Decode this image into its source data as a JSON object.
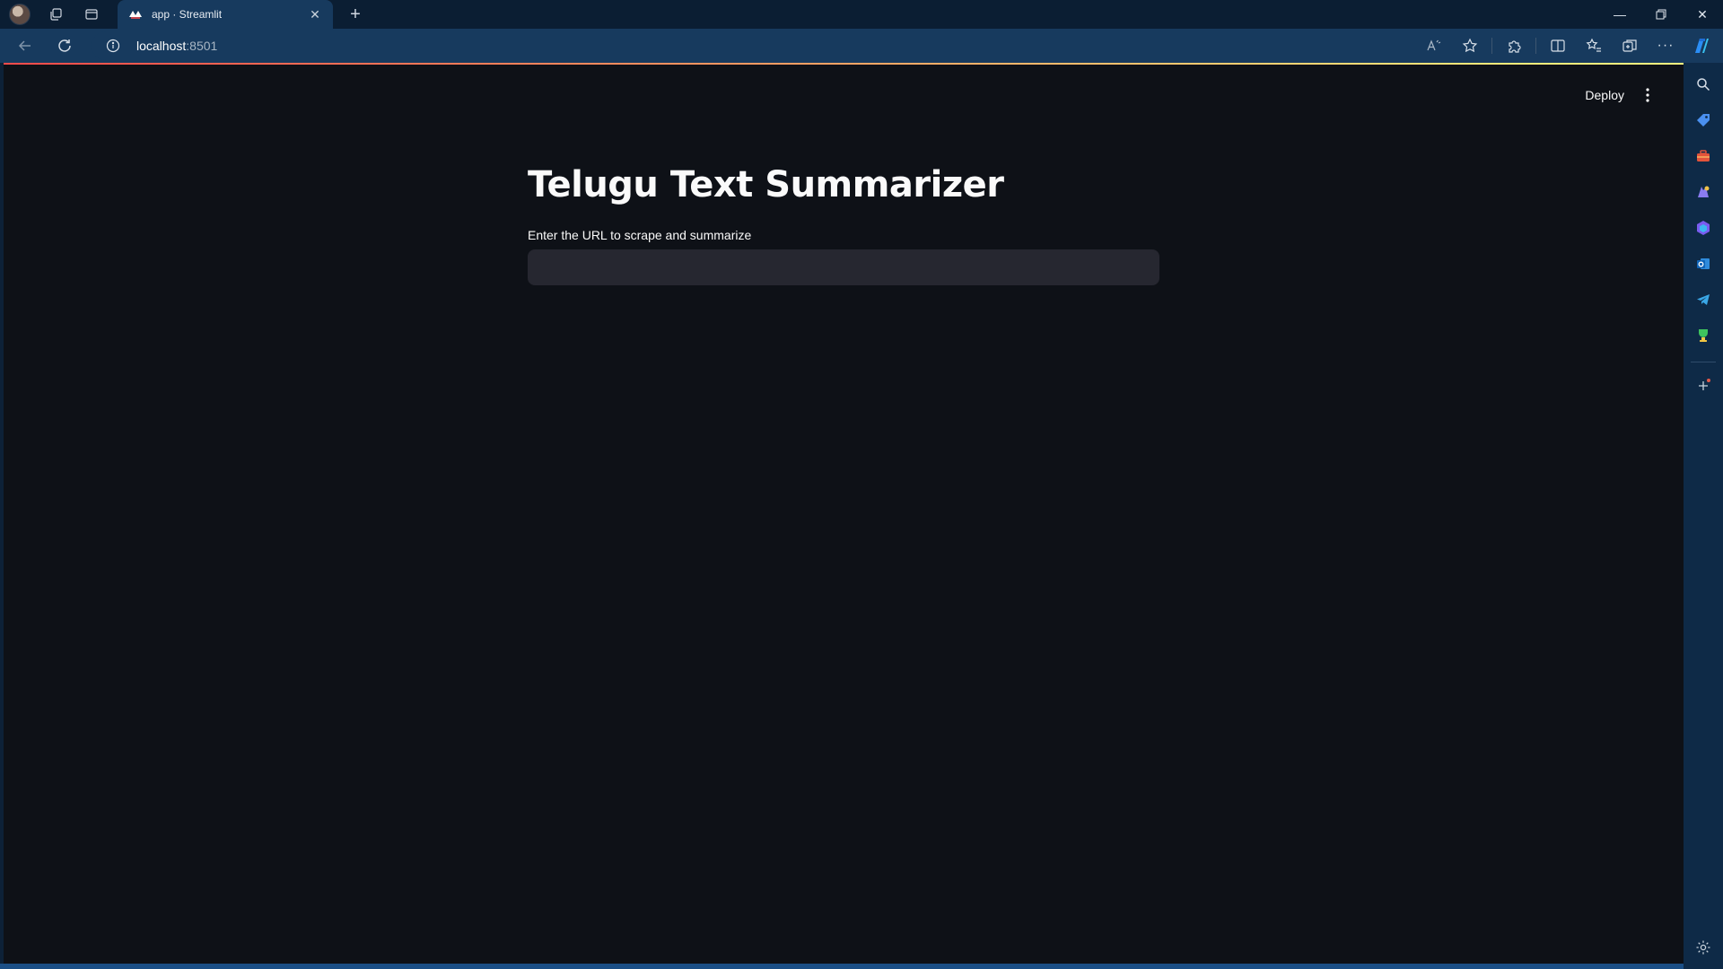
{
  "browser": {
    "tab": {
      "title": "app · Streamlit"
    },
    "address": {
      "host": "localhost",
      "port": ":8501"
    },
    "colors": {
      "accent_gradient_start": "#ff4b4b",
      "accent_gradient_end": "#fffd80",
      "page_background": "#0e1117",
      "input_background": "#262730"
    }
  },
  "app": {
    "header": {
      "deploy_label": "Deploy"
    },
    "title": "Telugu Text Summarizer",
    "url_input": {
      "label": "Enter the URL to scrape and summarize",
      "value": "",
      "placeholder": ""
    }
  },
  "edge_sidebar": {
    "items": [
      "search-icon",
      "shopping-tag-icon",
      "toolbox-icon",
      "games-icon",
      "copilot-icon",
      "outlook-icon",
      "telegram-icon",
      "trophy-icon",
      "add-icon",
      "settings-icon"
    ]
  }
}
